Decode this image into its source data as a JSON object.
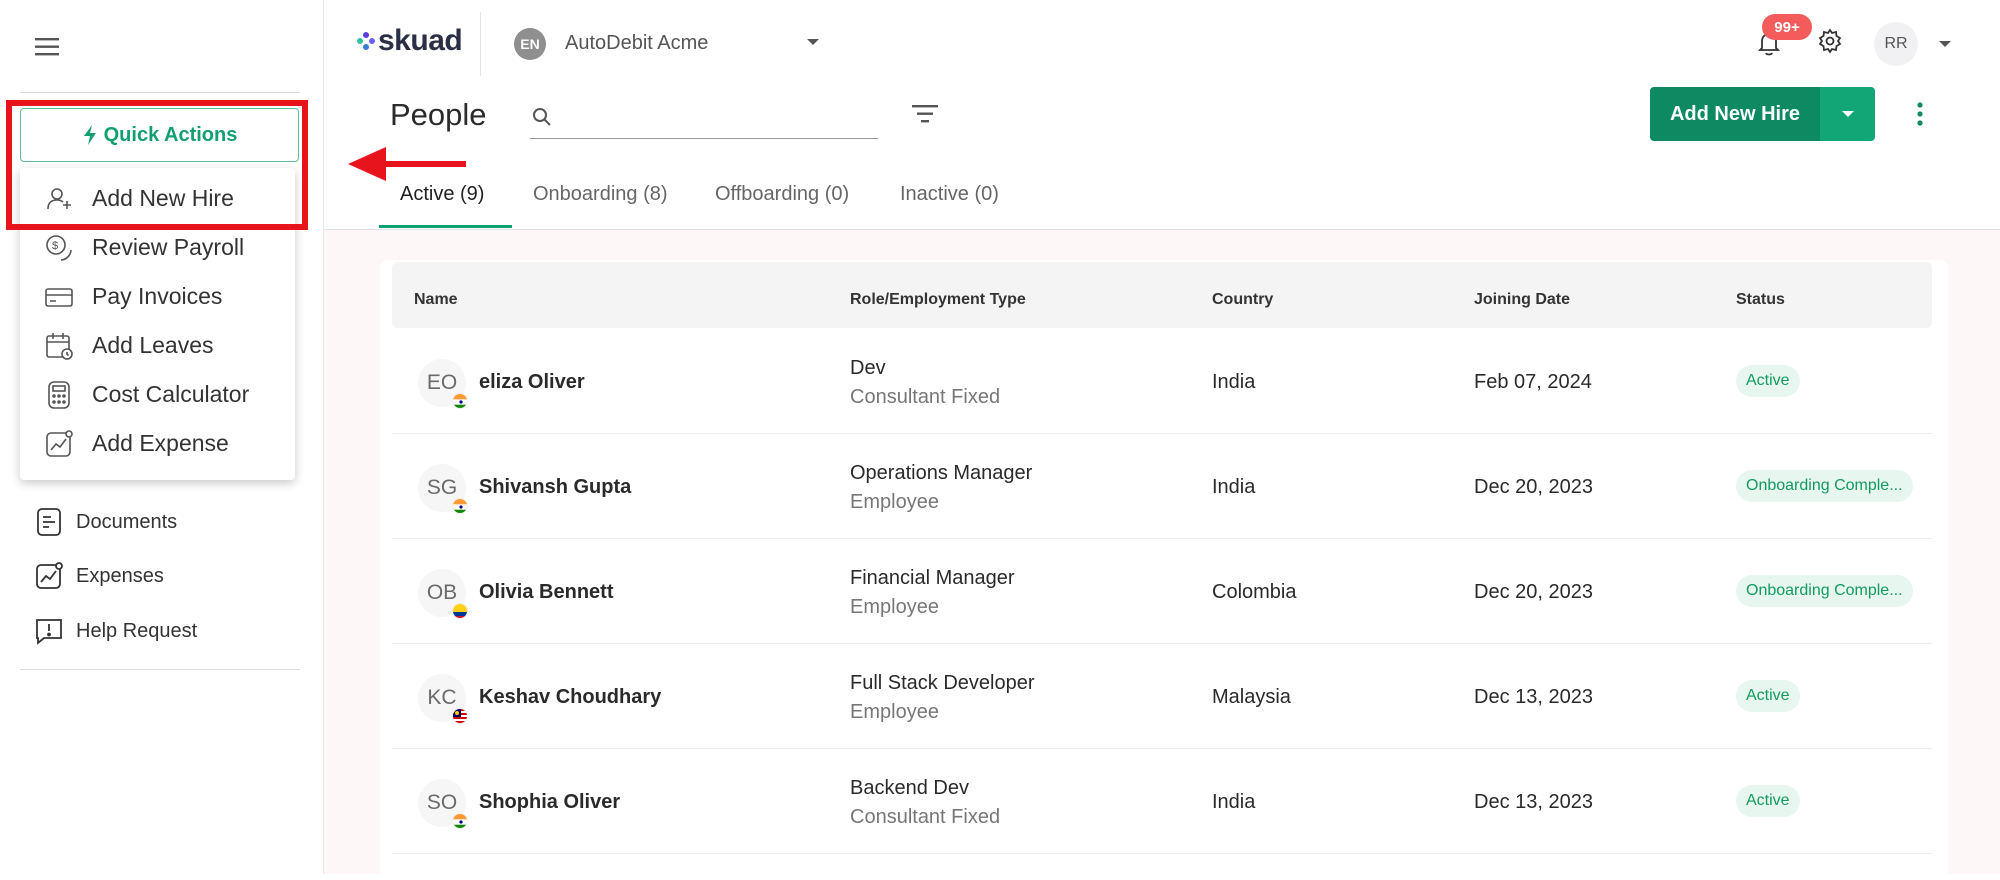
{
  "sidebar": {
    "quick_actions_label": "Quick Actions",
    "quick_actions_menu": [
      {
        "label": "Add New Hire",
        "icon": "add-user-icon"
      },
      {
        "label": "Review Payroll",
        "icon": "coins-icon"
      },
      {
        "label": "Pay Invoices",
        "icon": "card-icon"
      },
      {
        "label": "Add Leaves",
        "icon": "calendar-icon"
      },
      {
        "label": "Cost Calculator",
        "icon": "calculator-icon"
      },
      {
        "label": "Add Expense",
        "icon": "chart-icon"
      }
    ],
    "nav": [
      {
        "label": "Documents",
        "icon": "document-icon"
      },
      {
        "label": "Expenses",
        "icon": "expense-chart-icon"
      },
      {
        "label": "Help Request",
        "icon": "help-icon"
      }
    ]
  },
  "header": {
    "logo_text": "skuad",
    "company_initials": "EN",
    "company_name": "AutoDebit Acme",
    "notification_badge": "99+",
    "user_initials": "RR"
  },
  "page": {
    "title": "People",
    "search_placeholder": "",
    "add_hire_label": "Add New Hire"
  },
  "tabs": [
    {
      "label": "Active (9)",
      "active": true
    },
    {
      "label": "Onboarding (8)",
      "active": false
    },
    {
      "label": "Offboarding (0)",
      "active": false
    },
    {
      "label": "Inactive (0)",
      "active": false
    }
  ],
  "table": {
    "columns": [
      "Name",
      "Role/Employment Type",
      "Country",
      "Joining Date",
      "Status"
    ],
    "rows": [
      {
        "initials": "EO",
        "flag": "india",
        "name": "eliza Oliver",
        "role": "Dev",
        "type": "Consultant Fixed",
        "country": "India",
        "date": "Feb 07, 2024",
        "status": "Active"
      },
      {
        "initials": "SG",
        "flag": "india",
        "name": "Shivansh Gupta",
        "role": "Operations Manager",
        "type": "Employee",
        "country": "India",
        "date": "Dec 20, 2023",
        "status": "Onboarding Comple..."
      },
      {
        "initials": "OB",
        "flag": "colombia",
        "name": "Olivia Bennett",
        "role": "Financial Manager",
        "type": "Employee",
        "country": "Colombia",
        "date": "Dec 20, 2023",
        "status": "Onboarding Comple..."
      },
      {
        "initials": "KC",
        "flag": "malaysia",
        "name": "Keshav Choudhary",
        "role": "Full Stack Developer",
        "type": "Employee",
        "country": "Malaysia",
        "date": "Dec 13, 2023",
        "status": "Active"
      },
      {
        "initials": "SO",
        "flag": "india",
        "name": "Shophia Oliver",
        "role": "Backend Dev",
        "type": "Consultant Fixed",
        "country": "India",
        "date": "Dec 13, 2023",
        "status": "Active"
      }
    ]
  },
  "colors": {
    "accent": "#12a070",
    "primary_button": "#0e8a62",
    "highlight": "#e8141c",
    "badge_bg": "#e7f6ee"
  }
}
